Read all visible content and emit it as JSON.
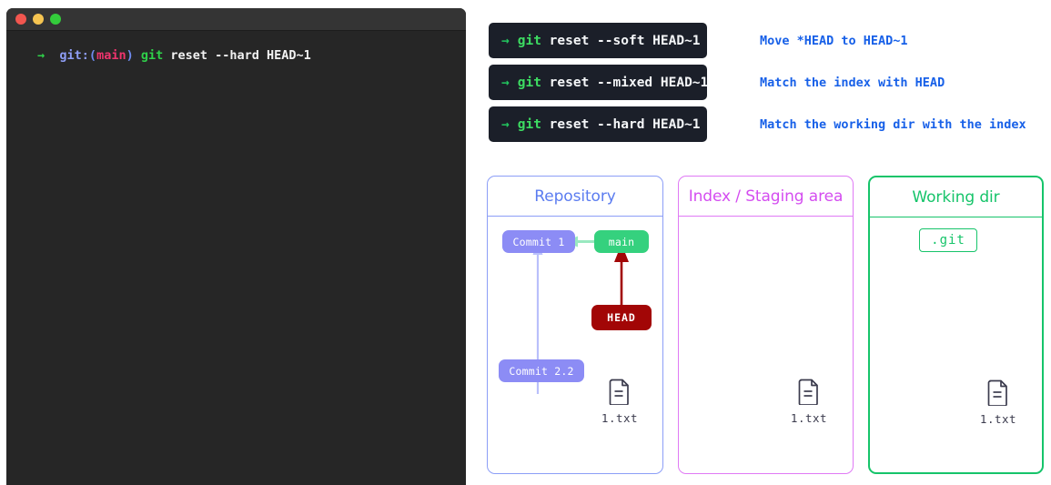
{
  "terminal": {
    "window_controls": [
      "close",
      "minimize",
      "maximize"
    ],
    "prompt_arrow": "→",
    "prompt_git_label": "git:",
    "prompt_paren_open": "(",
    "prompt_branch": "main",
    "prompt_paren_close": ")",
    "command_name": "git",
    "command_args": " reset --hard HEAD~1"
  },
  "commands": [
    {
      "arrow": "→",
      "name": "git",
      "args": " reset --soft HEAD~1",
      "description": "Move *HEAD to HEAD~1"
    },
    {
      "arrow": "→",
      "name": "git",
      "args": " reset --mixed HEAD~1",
      "description": "Match the index with HEAD"
    },
    {
      "arrow": "→",
      "name": "git",
      "args": " reset --hard HEAD~1",
      "description": "Match the working dir with the index"
    }
  ],
  "panels": {
    "repository": {
      "title": "Repository",
      "accent": "#5b7cf0",
      "border": "#8c9ef7",
      "nodes": {
        "commit1": "Commit 1",
        "commit22": "Commit 2.2",
        "branch": "main",
        "head": "HEAD"
      },
      "file": {
        "name": "1.txt",
        "icon": "file-icon"
      }
    },
    "index": {
      "title": "Index / Staging area",
      "accent": "#d44df0",
      "border": "#e07af5",
      "file": {
        "name": "1.txt",
        "icon": "file-icon"
      }
    },
    "working_dir": {
      "title": "Working dir",
      "accent": "#16c46a",
      "border": "#16c46a",
      "git_dir": ".git",
      "file": {
        "name": "1.txt",
        "icon": "file-icon"
      }
    }
  },
  "colors": {
    "page_background": "#ffffff",
    "terminal_background": "#262626",
    "terminal_titlebar": "#343434",
    "command_box_background": "#1b1f29",
    "command_green": "#3ddc62",
    "description_blue": "#1760e8",
    "commit_purple": "#8c8cf5",
    "branch_green": "#35d17e",
    "head_red": "#a20606",
    "file_icon": "#3c3c4e"
  }
}
